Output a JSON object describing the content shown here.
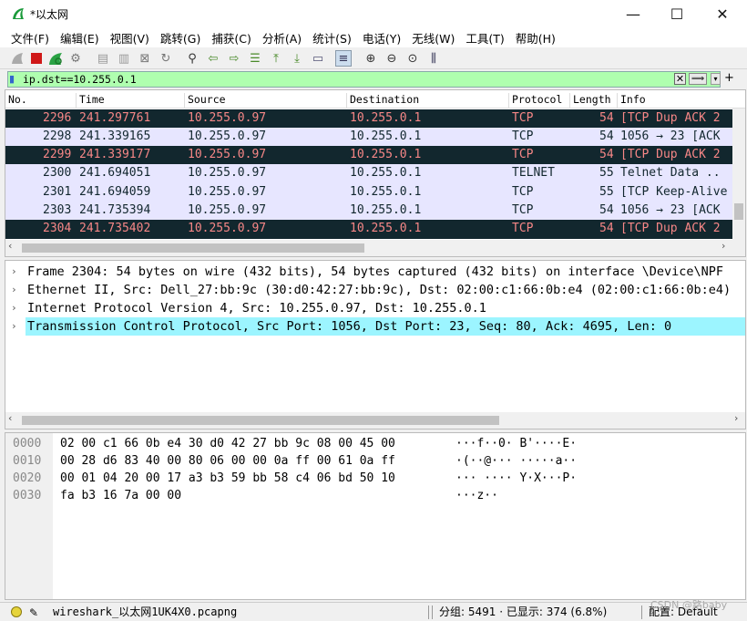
{
  "window": {
    "title": "*以太网",
    "min": "—",
    "max": "☐",
    "close": "✕"
  },
  "menu": [
    "文件(F)",
    "编辑(E)",
    "视图(V)",
    "跳转(G)",
    "捕获(C)",
    "分析(A)",
    "统计(S)",
    "电话(Y)",
    "无线(W)",
    "工具(T)",
    "帮助(H)"
  ],
  "filter": {
    "value": "ip.dst==10.255.0.1",
    "clear": "✕",
    "apply": "⟹",
    "dropdown": "▾",
    "add": "+"
  },
  "packet_list": {
    "columns": [
      "No.",
      "Time",
      "Source",
      "Destination",
      "Protocol",
      "Length",
      "Info"
    ],
    "rows": [
      {
        "no": "2296",
        "time": "241.297761",
        "src": "10.255.0.97",
        "dst": "10.255.0.1",
        "proto": "TCP",
        "len": "54",
        "info": "[TCP Dup ACK 2",
        "style": "dark"
      },
      {
        "no": "2298",
        "time": "241.339165",
        "src": "10.255.0.97",
        "dst": "10.255.0.1",
        "proto": "TCP",
        "len": "54",
        "info": "1056 → 23 [ACK",
        "style": "light"
      },
      {
        "no": "2299",
        "time": "241.339177",
        "src": "10.255.0.97",
        "dst": "10.255.0.1",
        "proto": "TCP",
        "len": "54",
        "info": "[TCP Dup ACK 2",
        "style": "dark"
      },
      {
        "no": "2300",
        "time": "241.694051",
        "src": "10.255.0.97",
        "dst": "10.255.0.1",
        "proto": "TELNET",
        "len": "55",
        "info": "Telnet Data ..",
        "style": "light"
      },
      {
        "no": "2301",
        "time": "241.694059",
        "src": "10.255.0.97",
        "dst": "10.255.0.1",
        "proto": "TCP",
        "len": "55",
        "info": "[TCP Keep-Alive",
        "style": "light"
      },
      {
        "no": "2303",
        "time": "241.735394",
        "src": "10.255.0.97",
        "dst": "10.255.0.1",
        "proto": "TCP",
        "len": "54",
        "info": "1056 → 23 [ACK",
        "style": "light"
      },
      {
        "no": "2304",
        "time": "241.735402",
        "src": "10.255.0.97",
        "dst": "10.255.0.1",
        "proto": "TCP",
        "len": "54",
        "info": "[TCP Dup ACK 2",
        "style": "dark"
      }
    ]
  },
  "details": [
    {
      "text": "Frame 2304: 54 bytes on wire (432 bits), 54 bytes captured (432 bits) on interface \\Device\\NPF",
      "selected": false
    },
    {
      "text": "Ethernet II, Src: Dell_27:bb:9c (30:d0:42:27:bb:9c), Dst: 02:00:c1:66:0b:e4 (02:00:c1:66:0b:e4)",
      "selected": false
    },
    {
      "text": "Internet Protocol Version 4, Src: 10.255.0.97, Dst: 10.255.0.1",
      "selected": false
    },
    {
      "text": "Transmission Control Protocol, Src Port: 1056, Dst Port: 23, Seq: 80, Ack: 4695, Len: 0",
      "selected": true
    }
  ],
  "bytes": [
    {
      "offset": "0000",
      "hex": "02 00 c1 66 0b e4 30 d0  42 27 bb 9c 08 00 45 00",
      "ascii": "···f··0· B'····E·"
    },
    {
      "offset": "0010",
      "hex": "00 28 d6 83 40 00 80 06  00 00 0a ff 00 61 0a ff",
      "ascii": "·(··@··· ·····a··"
    },
    {
      "offset": "0020",
      "hex": "00 01 04 20 00 17 a3 b3  59 bb 58 c4 06 bd 50 10",
      "ascii": "··· ···· Y·X···P·"
    },
    {
      "offset": "0030",
      "hex": "fa b3 16 7a 00 00",
      "ascii": "···z··"
    }
  ],
  "status": {
    "file": "wireshark_以太网1UK4X0.pcapng",
    "packets": "分组: 5491 · 已显示: 374 (6.8%)",
    "profile": "配置: Default",
    "watermark": "CSDN @路baby"
  },
  "colors": {
    "dark_row_bg": "#12272e",
    "dark_row_fg": "#f78787",
    "light_row_bg": "#e7e6ff",
    "filter_ok": "#afffaf",
    "selected_detail": "#9cf5ff"
  }
}
